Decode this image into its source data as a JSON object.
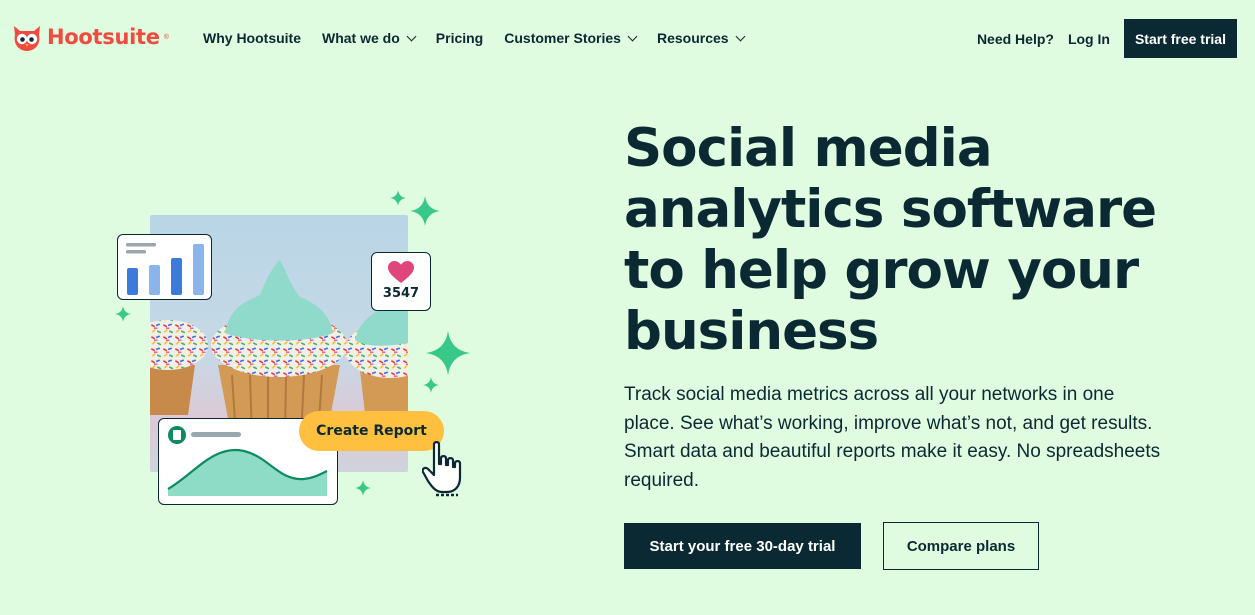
{
  "nav": {
    "brand": "Hootsuite",
    "brand_mark": "®",
    "items": [
      {
        "label": "Why Hootsuite",
        "dropdown": false
      },
      {
        "label": "What we do",
        "dropdown": true
      },
      {
        "label": "Pricing",
        "dropdown": false
      },
      {
        "label": "Customer Stories",
        "dropdown": true
      },
      {
        "label": "Resources",
        "dropdown": true
      }
    ],
    "help": "Need Help?",
    "login": "Log In",
    "cta": "Start free trial"
  },
  "hero": {
    "headline": "Social media\nanalytics software\nto help grow your\nbusiness",
    "body": "Track social media metrics across all your networks in one place. See what’s working, improve what’s not, and get results. Smart data and beautiful reports make it easy. No spreadsheets required.",
    "primary_cta": "Start your free 30-day trial",
    "secondary_cta": "Compare plans"
  },
  "illustration": {
    "likes_count": "3547",
    "report_button": "Create Report",
    "icons": [
      "owl-logo-icon",
      "bar-chart-icon",
      "heart-icon",
      "document-icon",
      "area-chart-icon",
      "sparkle-icon",
      "hand-cursor-icon"
    ]
  },
  "colors": {
    "background": "#dffbe0",
    "navy": "#0b2933",
    "brand_red": "#ef4b3f",
    "accent_yellow": "#ffbf3f",
    "sparkle_green": "#38c98a",
    "bar_blue": "#3b7bdc",
    "heart_pink": "#e0467a",
    "chart_teal": "#8edcc5"
  }
}
